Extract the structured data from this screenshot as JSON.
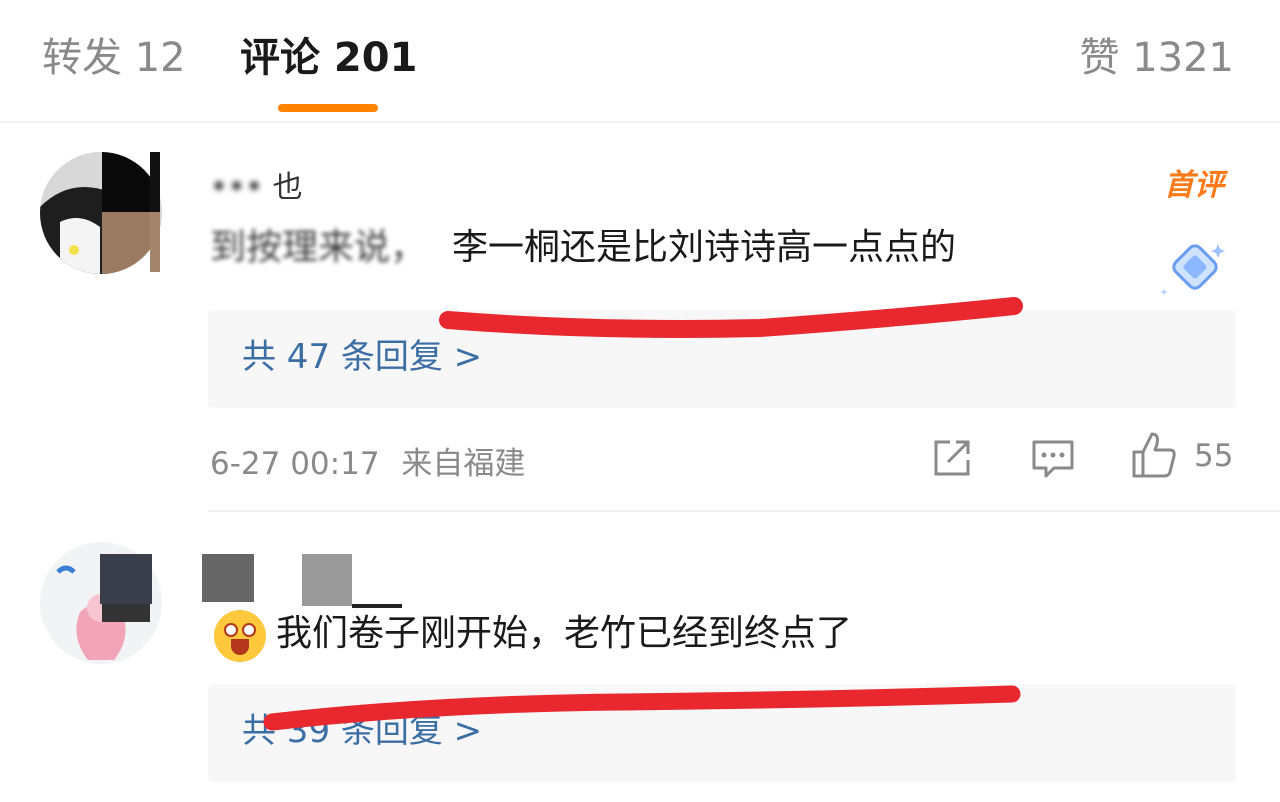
{
  "tabs": {
    "repost": "转发 12",
    "comments": "评论 201",
    "likes": "赞 1321"
  },
  "comments": [
    {
      "username_fragment": "也",
      "badge": "首评",
      "text_obscured": "到按理来说，",
      "text": "李一桐还是比刘诗诗高一点点的",
      "replies": "共 47 条回复 >",
      "timestamp": "6-27 00:17",
      "location": "来自福建",
      "like_count": "55"
    },
    {
      "text": "我们卷子刚开始，老竹已经到终点了",
      "replies": "共 39 条回复 >"
    }
  ],
  "colors": {
    "accent": "#ff8200",
    "link": "#3b6ea5",
    "badge": "#ff7b1a",
    "annotation": "#e8272f"
  }
}
